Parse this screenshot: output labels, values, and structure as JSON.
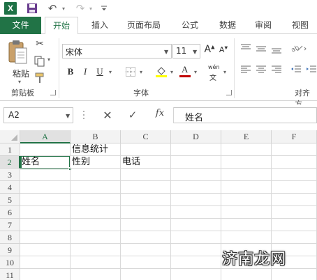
{
  "qat": {
    "app_logo": "X",
    "icons": [
      "excel-logo",
      "save-icon",
      "undo-icon",
      "redo-icon",
      "customize-icon"
    ]
  },
  "tabs": {
    "file": "文件",
    "home": "开始",
    "insert": "插入",
    "page_layout": "页面布局",
    "formulas": "公式",
    "data": "数据",
    "review": "审阅",
    "view": "视图",
    "active": "home"
  },
  "ribbon": {
    "clipboard": {
      "group_label": "剪贴板",
      "paste_label": "粘贴"
    },
    "font": {
      "group_label": "字体",
      "font_name": "宋体",
      "font_size": "11",
      "grow_label": "A",
      "shrink_label": "A",
      "bold_label": "B",
      "italic_label": "I",
      "underline_label": "U",
      "font_color_label": "A",
      "phonetic_label": "wén"
    },
    "alignment": {
      "group_label": "对齐方"
    },
    "colors": {
      "accent": "#217346",
      "fill_color_bar": "#ffff00",
      "font_color_bar": "#c00000"
    }
  },
  "formula_bar": {
    "name_box": "A2",
    "cancel_symbol": "✕",
    "enter_symbol": "✓",
    "fx_label": "fx",
    "value": "姓名"
  },
  "sheet": {
    "columns": [
      "A",
      "B",
      "C",
      "D",
      "E",
      "F"
    ],
    "rows": [
      "1",
      "2",
      "3",
      "4",
      "5",
      "6",
      "7",
      "8",
      "9",
      "10",
      "11"
    ],
    "active_cell": "A2",
    "cells": {
      "B1": "信息统计",
      "A2": "姓名",
      "B2": "性别",
      "C2": "电话"
    }
  },
  "watermark": "济南龙网"
}
